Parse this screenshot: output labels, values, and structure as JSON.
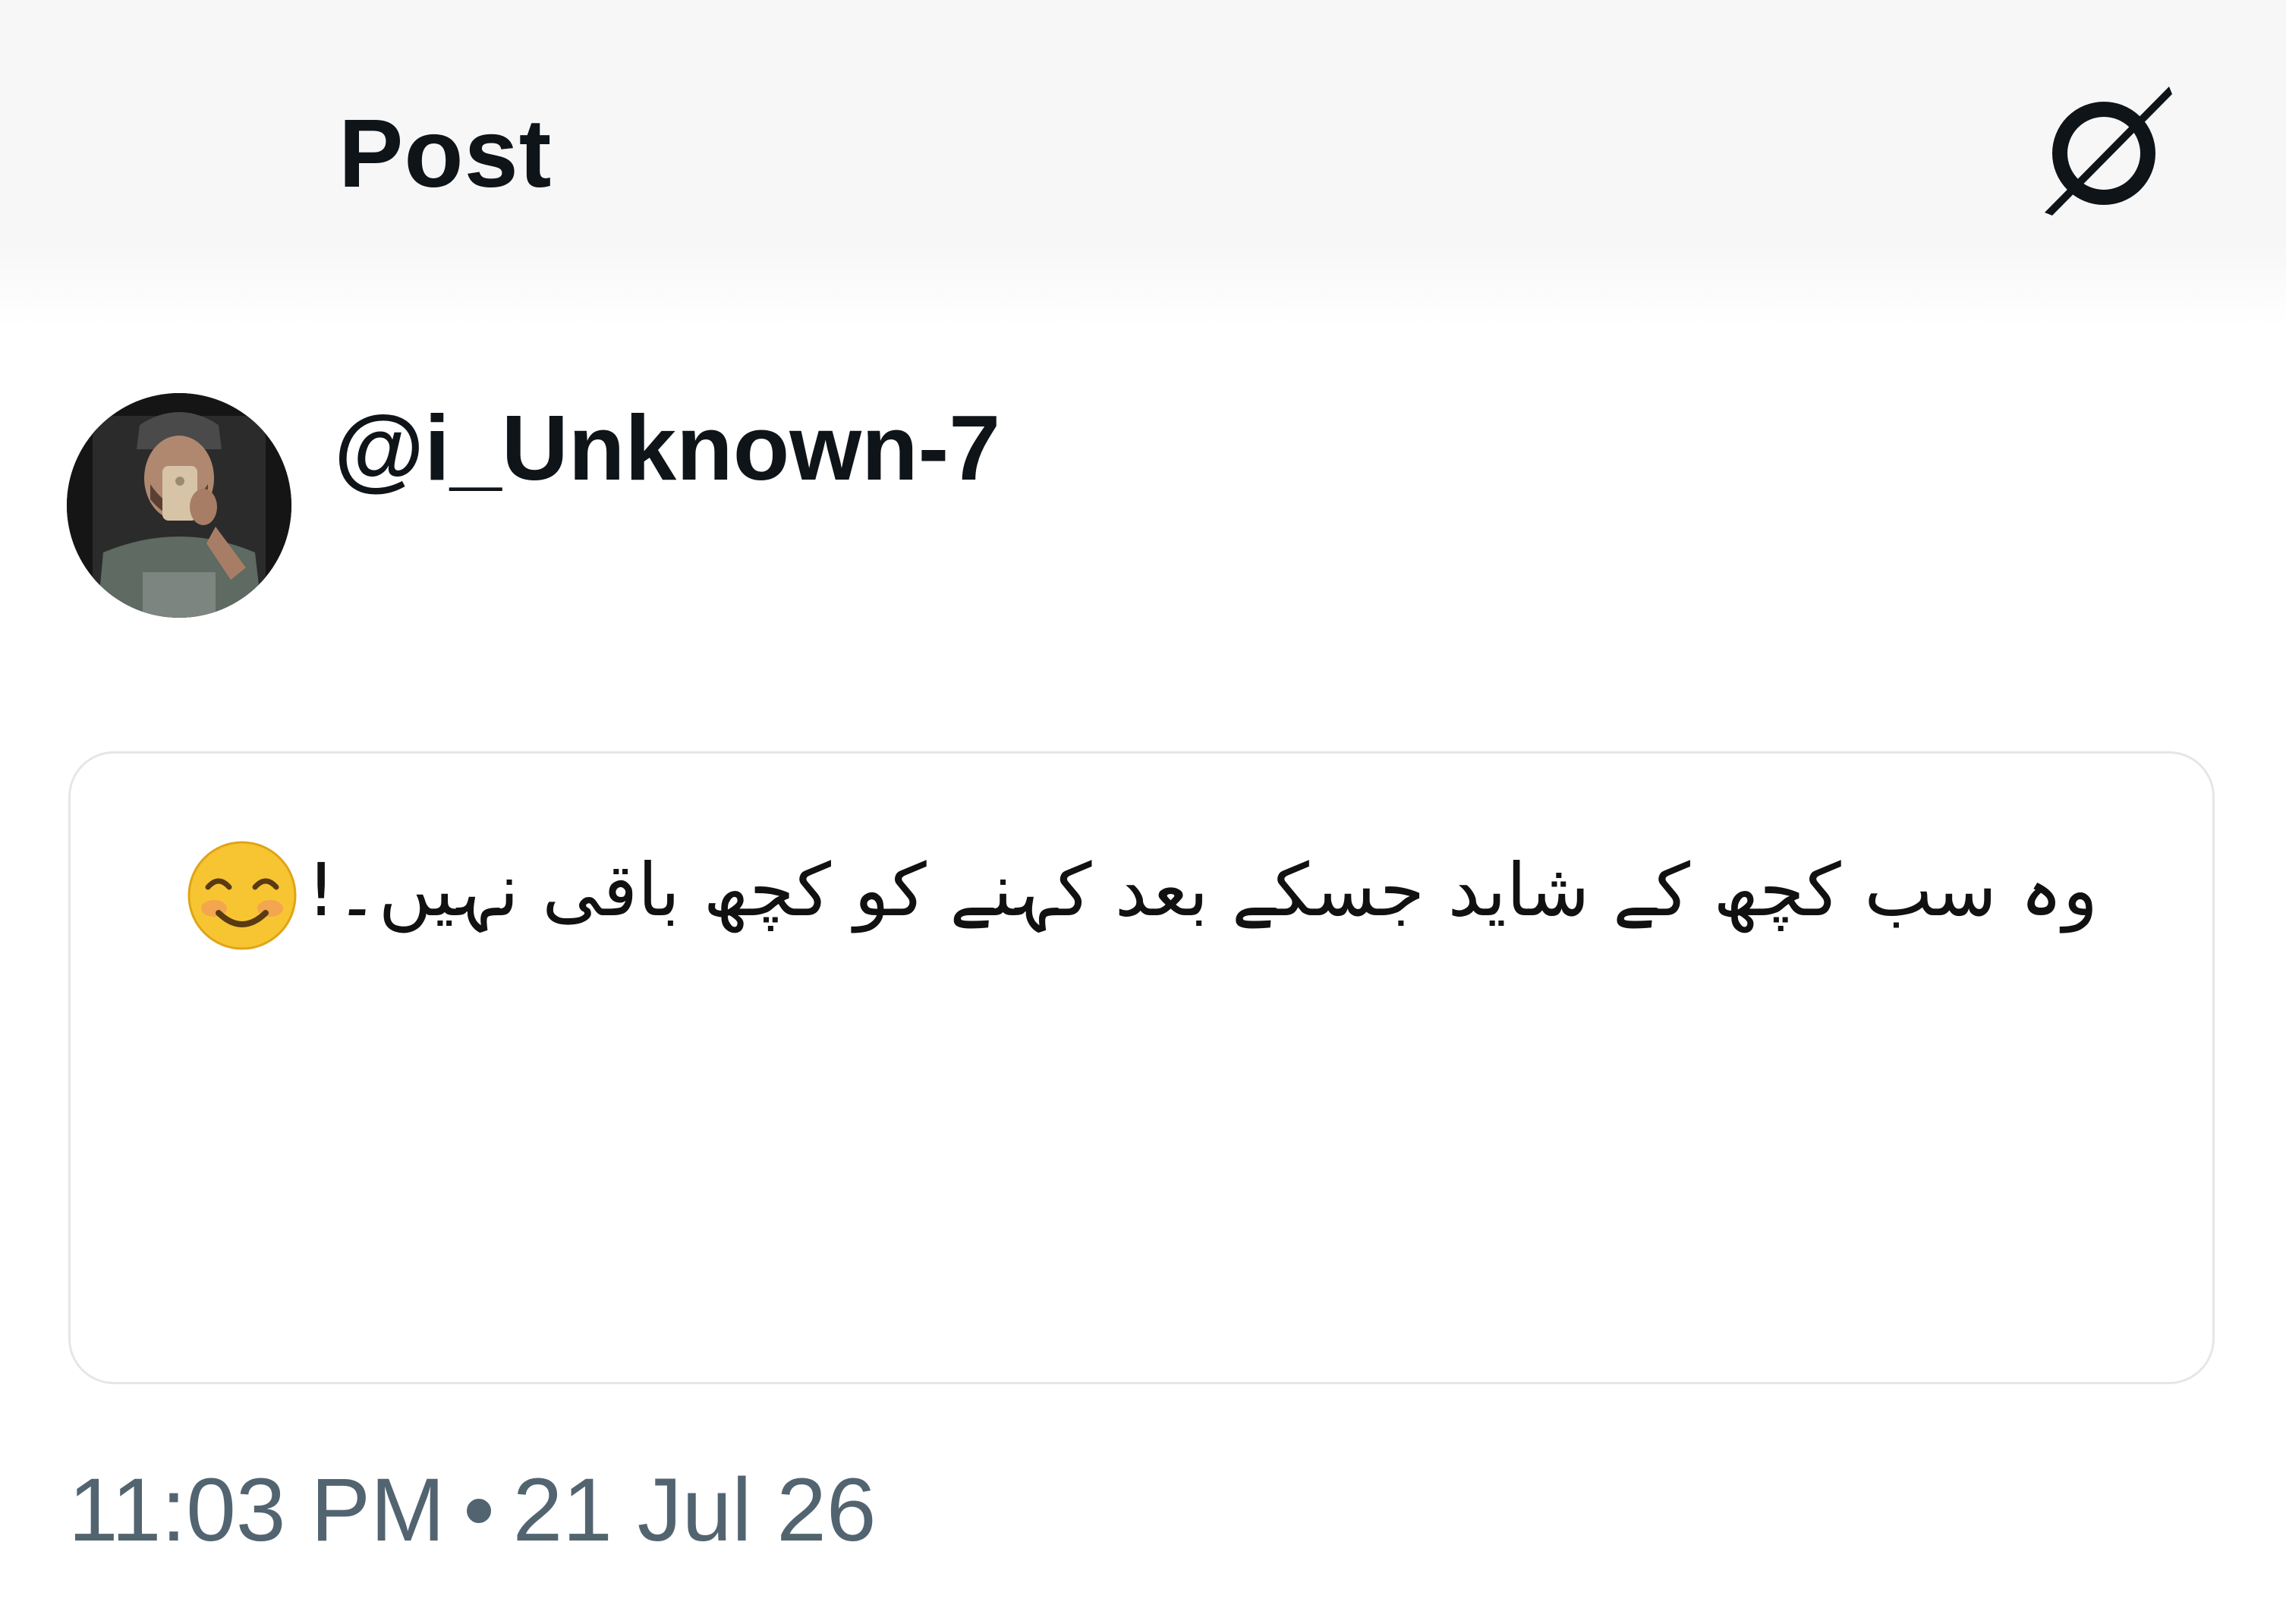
{
  "header": {
    "title": "Post",
    "icon": "grok-slash-icon"
  },
  "author": {
    "handle": "@i_Unknown-7",
    "avatar_icon": "profile-photo"
  },
  "post": {
    "text": "وہ سب کچھ کے شاید جسکے بعد کہنے کو کچھ باقی نہیں۔!",
    "emoji": "smiling-face-icon"
  },
  "meta": {
    "time": "11:03 PM",
    "separator": "•",
    "date": "21 Jul 26"
  },
  "colors": {
    "text_primary": "#0f1419",
    "text_secondary": "#536471",
    "card_border": "#e6e6e6",
    "header_bg": "#f7f7f7",
    "emoji_yellow": "#f7c531"
  }
}
